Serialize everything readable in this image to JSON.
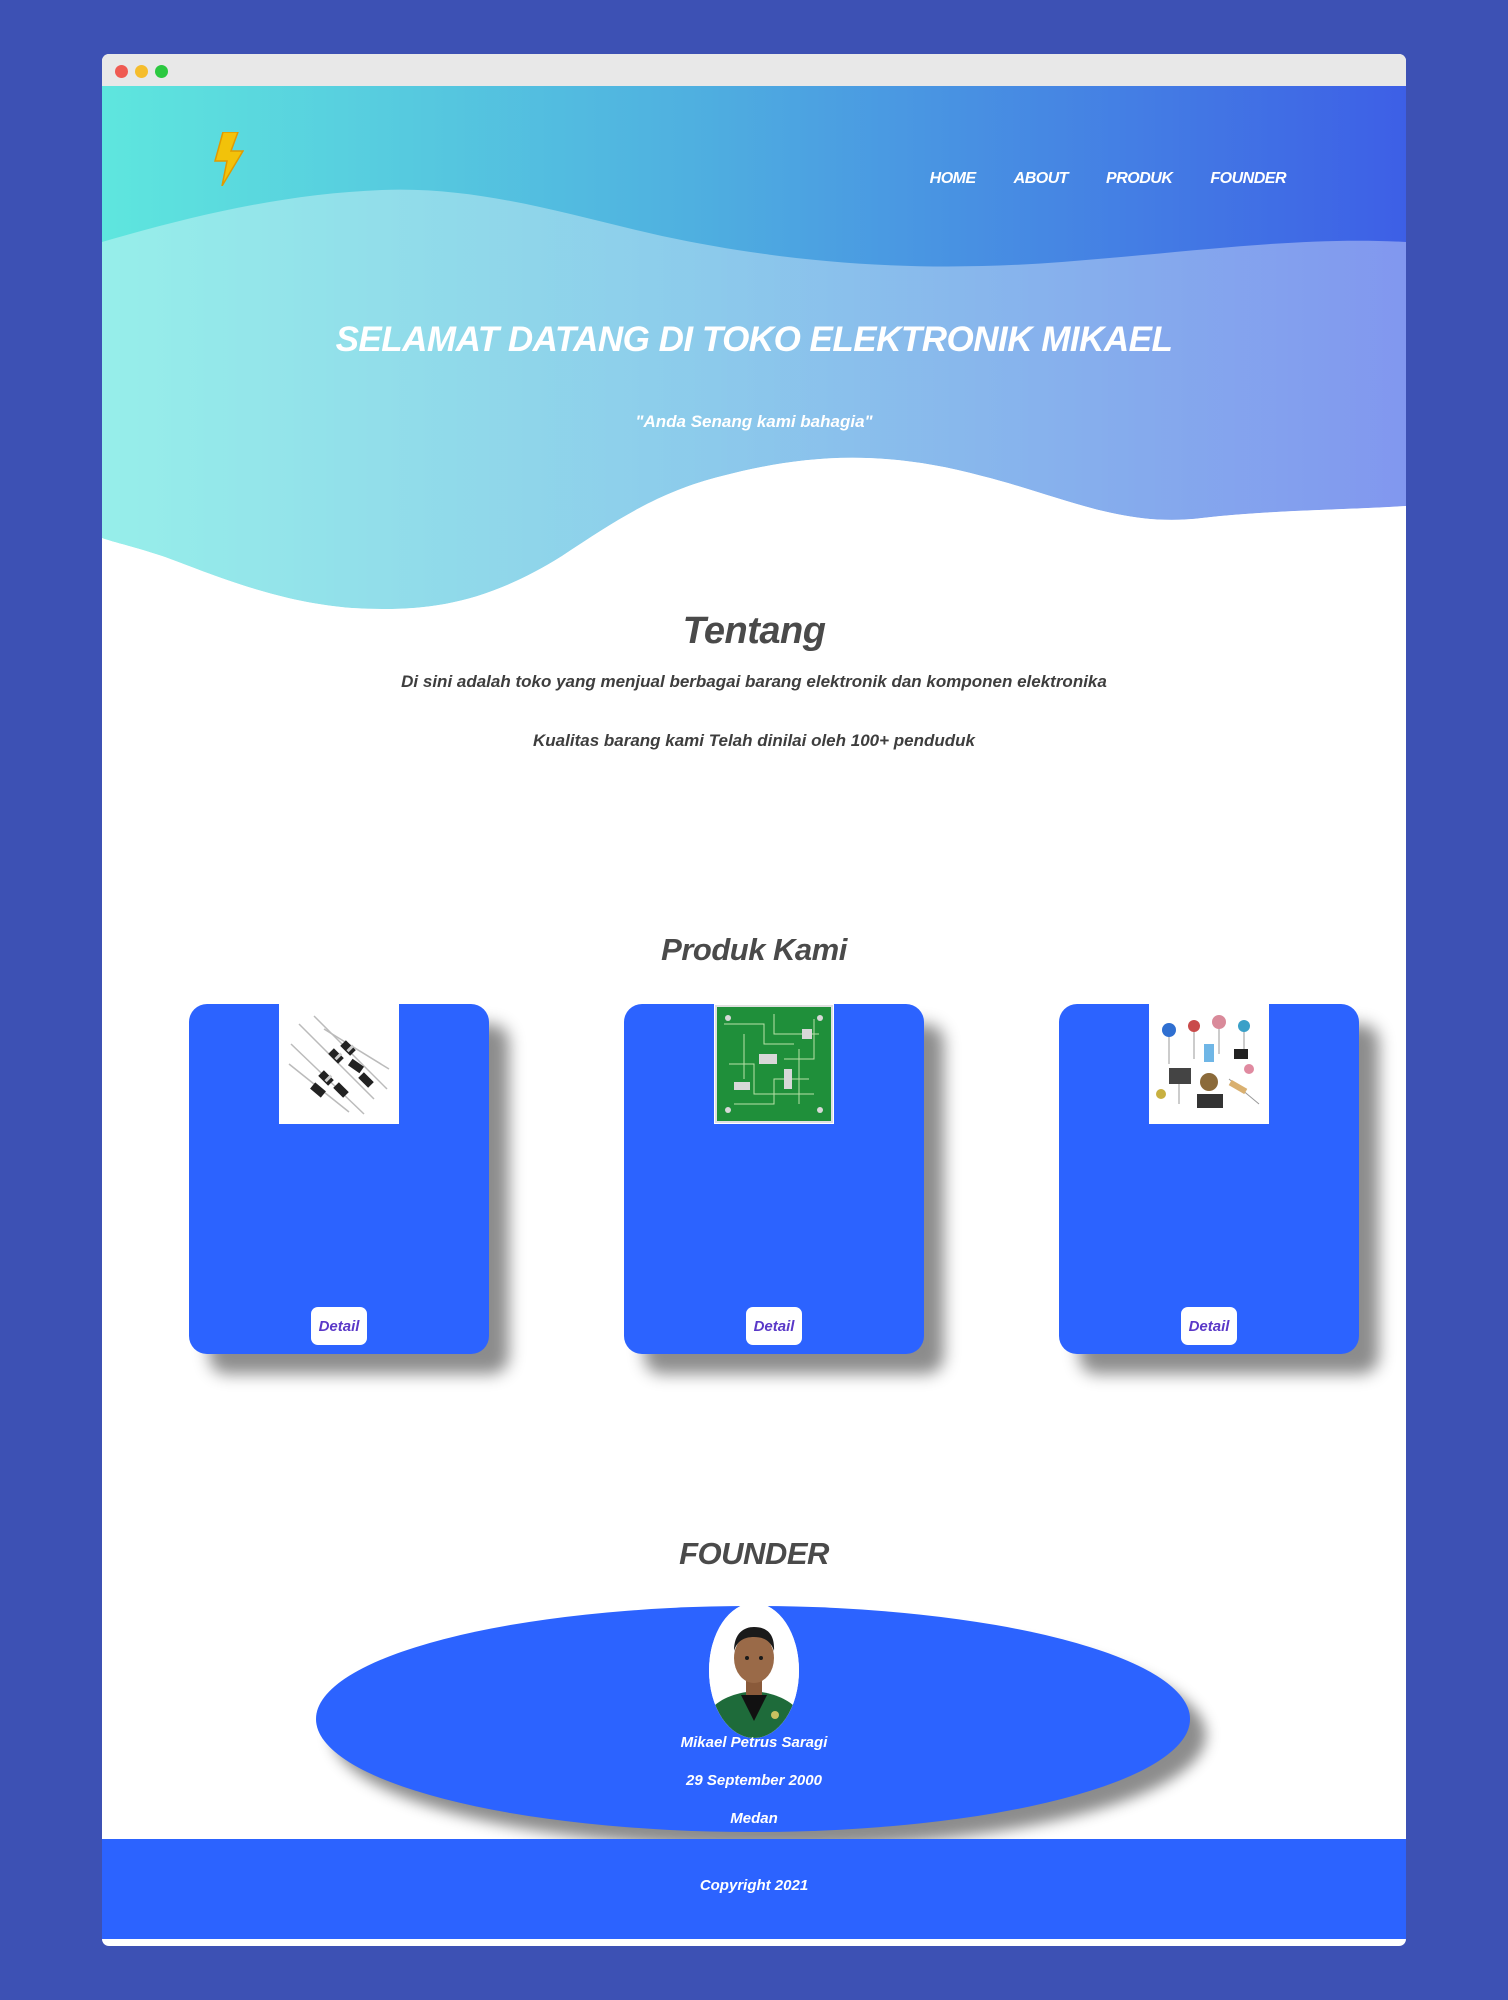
{
  "nav": {
    "items": [
      {
        "label": "HOME"
      },
      {
        "label": "ABOUT"
      },
      {
        "label": "PRODUK"
      },
      {
        "label": "FOUNDER"
      }
    ]
  },
  "hero": {
    "title": "SELAMAT DATANG DI TOKO ELEKTRONIK MIKAEL",
    "tagline": "\"Anda Senang kami bahagia\""
  },
  "about": {
    "title": "Tentang",
    "line1": "Di sini adalah toko yang menjual berbagai barang elektronik dan komponen elektronika",
    "line2": "Kualitas barang kami Telah dinilai oleh 100+ penduduk"
  },
  "products": {
    "title": "Produk Kami",
    "items": [
      {
        "button": "Detail"
      },
      {
        "button": "Detail"
      },
      {
        "button": "Detail"
      }
    ]
  },
  "founder": {
    "title": "FOUNDER",
    "name": "Mikael Petrus Saragi",
    "birth": "29 September 2000",
    "city": "Medan"
  },
  "footer": {
    "copyright": "Copyright 2021"
  },
  "colors": {
    "page_background": "#3d51b4",
    "primary_blue": "#2c63ff",
    "gradient_start": "#5ee6de",
    "gradient_end": "#3d5fe6",
    "button_text": "#5a38c8"
  }
}
